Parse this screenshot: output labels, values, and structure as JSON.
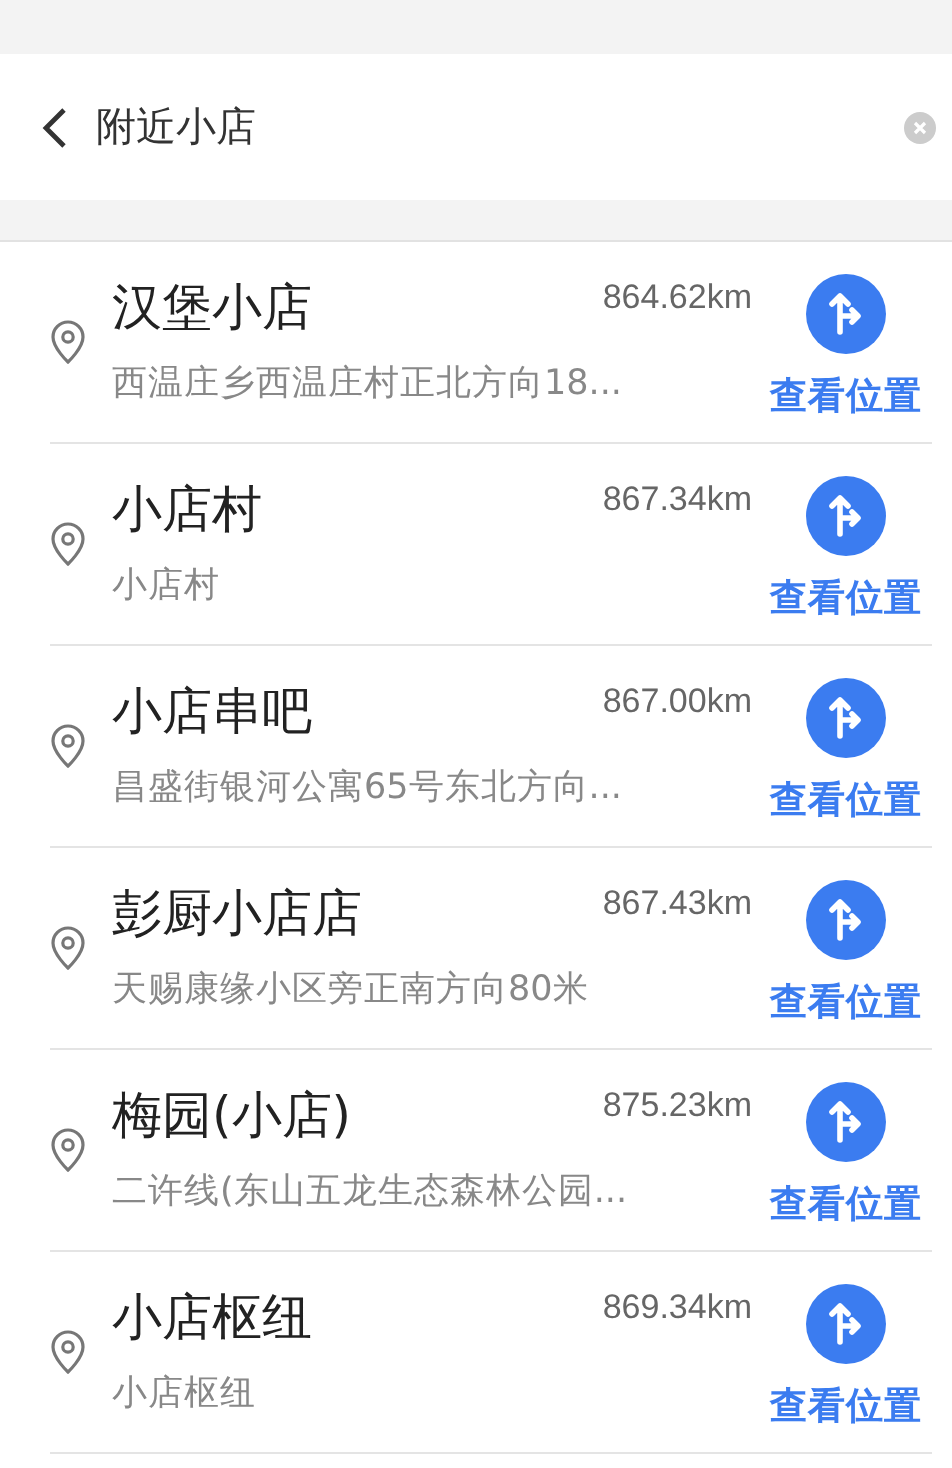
{
  "search": {
    "value": "附近小店"
  },
  "results": [
    {
      "name": "汉堡小店",
      "distance": "864.62km",
      "address": "西温庄乡西温庄村正北方向18...",
      "action": "查看位置"
    },
    {
      "name": "小店村",
      "distance": "867.34km",
      "address": "小店村",
      "action": "查看位置"
    },
    {
      "name": "小店串吧",
      "distance": "867.00km",
      "address": "昌盛街银河公寓65号东北方向...",
      "action": "查看位置"
    },
    {
      "name": "彭厨小店店",
      "distance": "867.43km",
      "address": "天赐康缘小区旁正南方向80米",
      "action": "查看位置"
    },
    {
      "name": "梅园(小店)",
      "distance": "875.23km",
      "address": "二许线(东山五龙生态森林公园...",
      "action": "查看位置"
    },
    {
      "name": "小店枢纽",
      "distance": "869.34km",
      "address": "小店枢纽",
      "action": "查看位置"
    }
  ]
}
